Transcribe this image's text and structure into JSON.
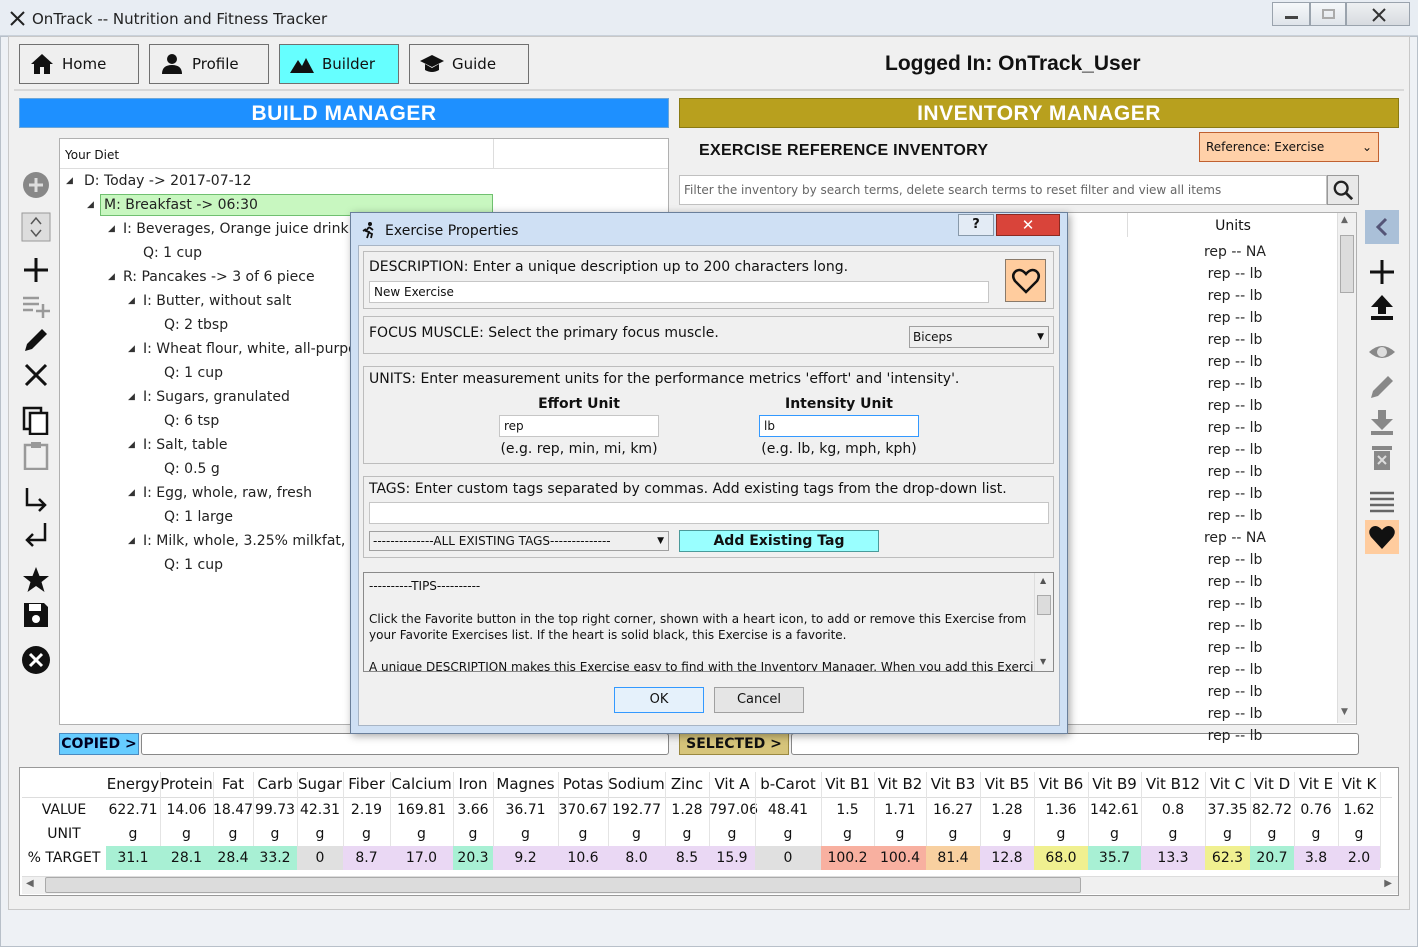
{
  "window": {
    "title": "OnTrack -- Nutrition and Fitness Tracker"
  },
  "nav": {
    "home": "Home",
    "profile": "Profile",
    "builder": "Builder",
    "guide": "Guide",
    "logged_in": "Logged In:  OnTrack_User"
  },
  "build_manager": {
    "title": "BUILD MANAGER",
    "tree_header": "Your Diet",
    "nodes": [
      "D: Today -> 2017-07-12",
      "M: Breakfast -> 06:30",
      "I: Beverages, Orange juice drink",
      "Q: 1 cup",
      "R: Pancakes -> 3 of 6 piece",
      "I: Butter, without salt",
      "Q: 2 tbsp",
      "I: Wheat flour, white, all-purpose",
      "Q: 1 cup",
      "I: Sugars, granulated",
      "Q: 6 tsp",
      "I: Salt, table",
      "Q: 0.5 g",
      "I: Egg, whole, raw, fresh",
      "Q: 1 large",
      "I: Milk, whole, 3.25% milkfat, with added vitamin D",
      "Q: 1 cup"
    ],
    "copied_label": "COPIED >",
    "selected_label": "SELECTED >"
  },
  "inventory": {
    "title": "INVENTORY MANAGER",
    "heading": "EXERCISE REFERENCE INVENTORY",
    "reference_select": "Reference: Exercise",
    "filter_placeholder": "Filter the inventory by search terms, delete search terms to reset filter and view all items",
    "units_header": "Units",
    "units": [
      "rep -- NA",
      "rep -- lb",
      "rep -- lb",
      "rep -- lb",
      "rep -- lb",
      "rep -- lb",
      "rep -- lb",
      "rep -- lb",
      "rep -- lb",
      "rep -- lb",
      "rep -- lb",
      "rep -- lb",
      "rep -- lb",
      "rep -- NA",
      "rep -- lb",
      "rep -- lb",
      "rep -- lb",
      "rep -- lb",
      "rep -- lb",
      "rep -- lb",
      "rep -- lb",
      "rep -- lb",
      "rep -- lb"
    ]
  },
  "nutrition": {
    "row_labels": [
      "VALUE",
      "UNIT",
      "% TARGET"
    ],
    "columns": [
      {
        "name": "Energy",
        "value": "622.71",
        "unit": "g",
        "target": "31.1",
        "color": "#a8f0d4"
      },
      {
        "name": "Protein",
        "value": "14.06",
        "unit": "g",
        "target": "28.1",
        "color": "#a8f0d4"
      },
      {
        "name": "Fat",
        "value": "18.47",
        "unit": "g",
        "target": "28.4",
        "color": "#a8f0d4"
      },
      {
        "name": "Carb",
        "value": "99.73",
        "unit": "g",
        "target": "33.2",
        "color": "#a8f0d4"
      },
      {
        "name": "Sugar",
        "value": "42.31",
        "unit": "g",
        "target": "0",
        "color": "#e0e0e0"
      },
      {
        "name": "Fiber",
        "value": "2.19",
        "unit": "g",
        "target": "8.7",
        "color": "#ead8f4"
      },
      {
        "name": "Calcium",
        "value": "169.81",
        "unit": "g",
        "target": "17.0",
        "color": "#ead8f4"
      },
      {
        "name": "Iron",
        "value": "3.66",
        "unit": "g",
        "target": "20.3",
        "color": "#a8f0d4"
      },
      {
        "name": "Magnes",
        "value": "36.71",
        "unit": "g",
        "target": "9.2",
        "color": "#ead8f4"
      },
      {
        "name": "Potas",
        "value": "370.67",
        "unit": "g",
        "target": "10.6",
        "color": "#ead8f4"
      },
      {
        "name": "Sodium",
        "value": "192.77",
        "unit": "g",
        "target": "8.0",
        "color": "#ead8f4"
      },
      {
        "name": "Zinc",
        "value": "1.28",
        "unit": "g",
        "target": "8.5",
        "color": "#ead8f4"
      },
      {
        "name": "Vit A",
        "value": "797.06",
        "unit": "g",
        "target": "15.9",
        "color": "#ead8f4"
      },
      {
        "name": "b-Carot",
        "value": "48.41",
        "unit": "g",
        "target": "0",
        "color": "#e0e0e0"
      },
      {
        "name": "Vit B1",
        "value": "1.5",
        "unit": "g",
        "target": "100.2",
        "color": "#f8b0a0"
      },
      {
        "name": "Vit B2",
        "value": "1.71",
        "unit": "g",
        "target": "100.4",
        "color": "#f8b0a0"
      },
      {
        "name": "Vit B3",
        "value": "16.27",
        "unit": "g",
        "target": "81.4",
        "color": "#f8d0a0"
      },
      {
        "name": "Vit B5",
        "value": "1.28",
        "unit": "g",
        "target": "12.8",
        "color": "#ead8f4"
      },
      {
        "name": "Vit B6",
        "value": "1.36",
        "unit": "g",
        "target": "68.0",
        "color": "#f0f090"
      },
      {
        "name": "Vit B9",
        "value": "142.61",
        "unit": "g",
        "target": "35.7",
        "color": "#a8f0d4"
      },
      {
        "name": "Vit B12",
        "value": "0.8",
        "unit": "g",
        "target": "13.3",
        "color": "#ead8f4"
      },
      {
        "name": "Vit C",
        "value": "37.35",
        "unit": "g",
        "target": "62.3",
        "color": "#f0f090"
      },
      {
        "name": "Vit D",
        "value": "82.72",
        "unit": "g",
        "target": "20.7",
        "color": "#a8f0d4"
      },
      {
        "name": "Vit E",
        "value": "0.76",
        "unit": "g",
        "target": "3.8",
        "color": "#ead8f4"
      },
      {
        "name": "Vit K",
        "value": "1.62",
        "unit": "g",
        "target": "2.0",
        "color": "#ead8f4"
      }
    ]
  },
  "dialog": {
    "title": "Exercise Properties",
    "description_label": "DESCRIPTION: Enter a unique description up to 200 characters long.",
    "description_value": "New Exercise",
    "focus_label": "FOCUS MUSCLE: Select the primary focus muscle.",
    "focus_value": "Biceps",
    "units_label": "UNITS: Enter measurement units for the performance metrics 'effort' and 'intensity'.",
    "effort_label": "Effort Unit",
    "effort_value": "rep",
    "effort_hint": "(e.g. rep, min, mi, km)",
    "intensity_label": "Intensity Unit",
    "intensity_value": "lb",
    "intensity_hint": "(e.g. lb, kg, mph, kph)",
    "tags_label": "TAGS: Enter custom tags separated by commas. Add existing tags from the drop-down list.",
    "tags_value": "",
    "tags_select": "--------------ALL EXISTING TAGS--------------",
    "add_tag_button": "Add Existing Tag",
    "tips_header": "----------TIPS----------",
    "tips_p1": "Click the Favorite button in the top right corner, shown with a heart icon, to add or remove this Exercise from your Favorite Exercises list. If the heart is solid black, this Exercise is a favorite.",
    "tips_p2": "A unique DESCRIPTION makes this Exercise easy to find with the Inventory Manager. When you add this Exercise to",
    "ok": "OK",
    "cancel": "Cancel",
    "help_glyph": "?",
    "close_glyph": "✕"
  }
}
